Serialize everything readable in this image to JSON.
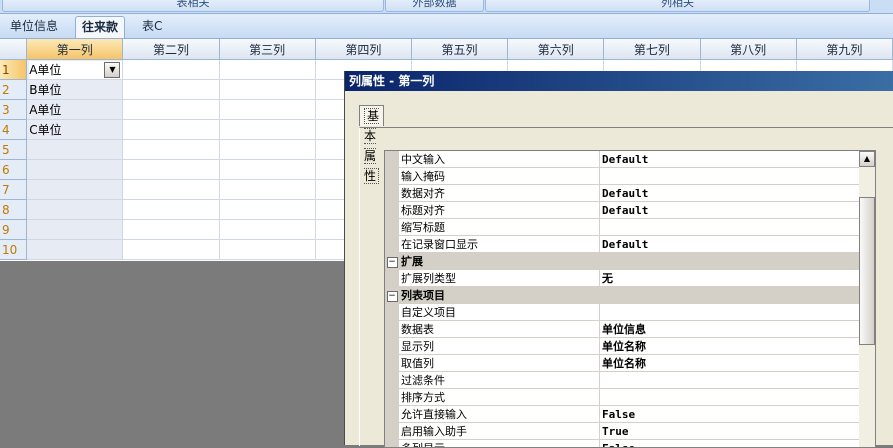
{
  "ribbon": {
    "buttons": [
      "表相关",
      "外部数据",
      "列相关"
    ]
  },
  "tabs": [
    {
      "label": "单位信息",
      "active": false
    },
    {
      "label": "往来款",
      "active": true
    },
    {
      "label": "表C",
      "active": false
    }
  ],
  "grid": {
    "columns": [
      "第一列",
      "第二列",
      "第三列",
      "第四列",
      "第五列",
      "第六列",
      "第七列",
      "第八列",
      "第九列"
    ],
    "rows": [
      {
        "num": "1",
        "value": "A单位"
      },
      {
        "num": "2",
        "value": "B单位"
      },
      {
        "num": "3",
        "value": "A单位"
      },
      {
        "num": "4",
        "value": "C单位"
      },
      {
        "num": "5",
        "value": ""
      },
      {
        "num": "6",
        "value": ""
      },
      {
        "num": "7",
        "value": ""
      },
      {
        "num": "8",
        "value": ""
      },
      {
        "num": "9",
        "value": ""
      },
      {
        "num": "10",
        "value": ""
      }
    ]
  },
  "dialog": {
    "title": "列属性 - 第一列",
    "tab": "基本属性",
    "properties": [
      {
        "type": "prop",
        "name": "中文输入",
        "value": "Default"
      },
      {
        "type": "prop",
        "name": "输入掩码",
        "value": ""
      },
      {
        "type": "prop",
        "name": "数据对齐",
        "value": "Default"
      },
      {
        "type": "prop",
        "name": "标题对齐",
        "value": "Default"
      },
      {
        "type": "prop",
        "name": "缩写标题",
        "value": ""
      },
      {
        "type": "prop",
        "name": "在记录窗口显示",
        "value": "Default"
      },
      {
        "type": "category",
        "name": "扩展",
        "toggle": "⊟"
      },
      {
        "type": "prop",
        "name": "扩展列类型",
        "value": "无"
      },
      {
        "type": "category",
        "name": "列表项目",
        "toggle": "⊟"
      },
      {
        "type": "prop",
        "name": "自定义项目",
        "value": ""
      },
      {
        "type": "prop",
        "name": "数据表",
        "value": "单位信息"
      },
      {
        "type": "prop",
        "name": "显示列",
        "value": "单位名称"
      },
      {
        "type": "prop",
        "name": "取值列",
        "value": "单位名称"
      },
      {
        "type": "prop",
        "name": "过滤条件",
        "value": ""
      },
      {
        "type": "prop",
        "name": "排序方式",
        "value": ""
      },
      {
        "type": "prop",
        "name": "允许直接输入",
        "value": "False"
      },
      {
        "type": "prop",
        "name": "启用输入助手",
        "value": "True"
      },
      {
        "type": "prop",
        "name": "多列显示",
        "value": "False"
      }
    ]
  }
}
